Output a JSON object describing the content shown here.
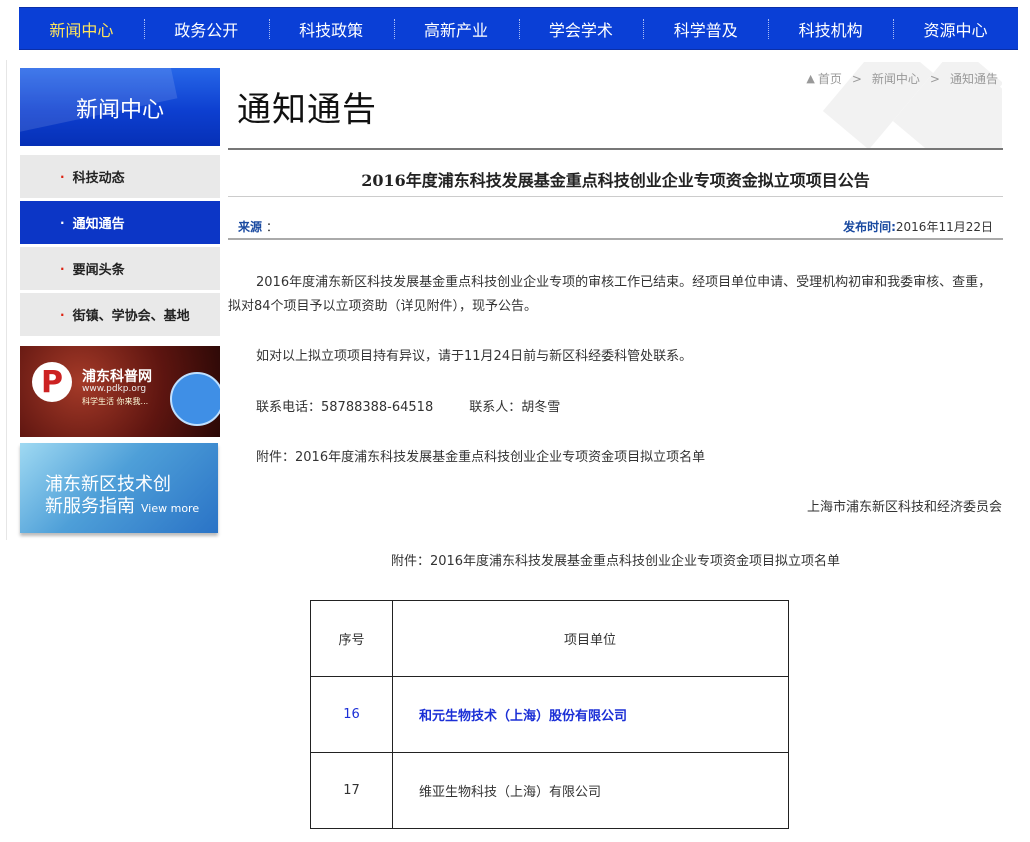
{
  "nav": {
    "items": [
      "新闻中心",
      "政务公开",
      "科技政策",
      "高新产业",
      "学会学术",
      "科学普及",
      "科技机构",
      "资源中心"
    ]
  },
  "sidebar": {
    "banner_title": "新闻中心",
    "items": [
      "科技动态",
      "通知通告",
      "要闻头条",
      "街镇、学协会、基地"
    ]
  },
  "ads": {
    "pdkp": {
      "name": "浦东科普网",
      "url": "www.pdkp.org",
      "slogan": "科学生活 你来我..."
    },
    "guide": {
      "line1": "浦东新区技术创",
      "line2": "新服务指南",
      "view_more": "View more"
    }
  },
  "page": {
    "title": "通知通告"
  },
  "breadcrumb": {
    "home": "首页",
    "level1": "新闻中心",
    "level2": "通知通告"
  },
  "article": {
    "title": "2016年度浦东科技发展基金重点科技创业企业专项资金拟立项项目公告",
    "source_label": "来源",
    "source_value": "：",
    "date_label": "发布时间:",
    "date_value": "2016年11月22日",
    "p1": "2016年度浦东新区科技发展基金重点科技创业企业专项的审核工作已结束。经项目单位申请、受理机构初审和我委审核、查重，拟对84个项目予以立项资助（详见附件），现予公告。",
    "p2": "如对以上拟立项项目持有异议，请于11月24日前与新区科经委科管处联系。",
    "phone": "联系电话：58788388-64518",
    "contact": "联系人：胡冬雪",
    "attachment": "附件：2016年度浦东科技发展基金重点科技创业企业专项资金项目拟立项名单",
    "signature": "上海市浦东新区科技和经济委员会",
    "attachment_title": "附件：2016年度浦东科技发展基金重点科技创业企业专项资金项目拟立项名单"
  },
  "table": {
    "headers": [
      "序号",
      "项目单位"
    ],
    "rows": [
      {
        "no": "16",
        "company": "和元生物技术（上海）股份有限公司"
      },
      {
        "no": "17",
        "company": "维亚生物科技（上海）有限公司"
      }
    ]
  },
  "colors": {
    "nav_bg": "#0a3fd6",
    "nav_active": "#ffe55c",
    "sidebar_active": "#0c36c6",
    "highlight_row": "#1b2fd6"
  }
}
